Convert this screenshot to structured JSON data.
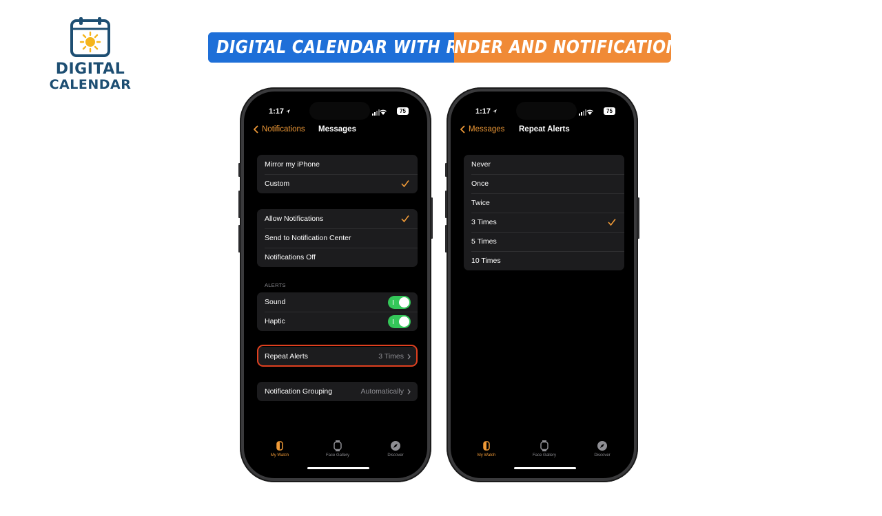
{
  "logo": {
    "line1": "DIGITAL",
    "line2": "CALENDAR"
  },
  "banner": {
    "part1": "DIGITAL CALENDAR WITH REMI",
    "part2": "NDER AND NOTIFICATIONS",
    "color_blue": "#1e6fd8",
    "color_orange": "#f08a36"
  },
  "phone_left": {
    "time": "1:17",
    "battery": "75",
    "back_label": "Notifications",
    "title": "Messages",
    "group1": [
      {
        "label": "Mirror my iPhone"
      },
      {
        "label": "Custom",
        "checked": true
      }
    ],
    "group2": [
      {
        "label": "Allow Notifications",
        "checked": true
      },
      {
        "label": "Send to Notification Center"
      },
      {
        "label": "Notifications Off"
      }
    ],
    "alerts_header": "ALERTS",
    "alerts": [
      {
        "label": "Sound",
        "on": true
      },
      {
        "label": "Haptic",
        "on": true
      }
    ],
    "repeat_alerts": {
      "label": "Repeat Alerts",
      "value": "3 Times"
    },
    "grouping": {
      "label": "Notification Grouping",
      "value": "Automatically"
    },
    "tabs": [
      {
        "label": "My Watch",
        "active": true
      },
      {
        "label": "Face Gallery"
      },
      {
        "label": "Discover"
      }
    ]
  },
  "phone_right": {
    "time": "1:17",
    "battery": "75",
    "back_label": "Messages",
    "title": "Repeat Alerts",
    "options": [
      {
        "label": "Never"
      },
      {
        "label": "Once"
      },
      {
        "label": "Twice"
      },
      {
        "label": "3 Times",
        "checked": true
      },
      {
        "label": "5 Times"
      },
      {
        "label": "10 Times"
      }
    ],
    "tabs": [
      {
        "label": "My Watch",
        "active": true
      },
      {
        "label": "Face Gallery"
      },
      {
        "label": "Discover"
      }
    ]
  },
  "colors": {
    "accent": "#f09a37",
    "toggle_on": "#34c759",
    "highlight": "#e0401f"
  }
}
